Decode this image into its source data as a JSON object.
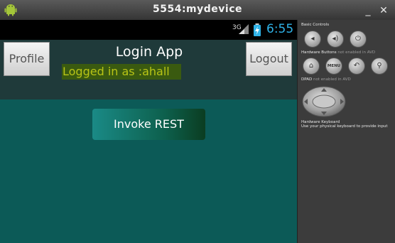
{
  "window": {
    "title": "5554:mydevice"
  },
  "statusbar": {
    "network": "3G",
    "time": "6:55"
  },
  "app": {
    "title": "Login App",
    "profile_label": "Profile",
    "logout_label": "Logout",
    "logged_in_text": "Logged in as :ahall",
    "invoke_label": "Invoke REST"
  },
  "panel": {
    "basic_controls": "Basic Controls",
    "hardware_buttons": "Hardware Buttons",
    "not_enabled": "not enabled in AVD",
    "dpad": "DPAD",
    "dpad_not_enabled": "not enabled in AVD",
    "hardware_keyboard": "Hardware Keyboard",
    "keyboard_hint": "Use your physical keyboard to provide input",
    "menu_label": "MENU"
  },
  "colors": {
    "app_background": "#0c5a57",
    "action_bar": "#1f3a3a",
    "clock": "#2fb3e8",
    "logged_text": "#b8c416"
  }
}
